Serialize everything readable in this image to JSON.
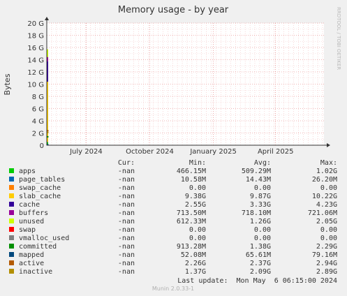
{
  "chart_data": {
    "type": "line",
    "title": "Memory usage - by year",
    "ylabel": "Bytes",
    "xlabel": "",
    "ylim": [
      0,
      20
    ],
    "y_unit": "G",
    "y_ticks": [
      {
        "value": 0,
        "label": "0"
      },
      {
        "value": 2,
        "label": "2 G"
      },
      {
        "value": 4,
        "label": "4 G"
      },
      {
        "value": 6,
        "label": "6 G"
      },
      {
        "value": 8,
        "label": "8 G"
      },
      {
        "value": 10,
        "label": "10 G"
      },
      {
        "value": 12,
        "label": "12 G"
      },
      {
        "value": 14,
        "label": "14 G"
      },
      {
        "value": 16,
        "label": "16 G"
      },
      {
        "value": 18,
        "label": "18 G"
      },
      {
        "value": 20,
        "label": "20 G"
      }
    ],
    "x_range": [
      "2024-05-05",
      "2025-06-10"
    ],
    "x_ticks": [
      {
        "date": "2024-07-01",
        "label": "July 2024"
      },
      {
        "date": "2024-10-01",
        "label": "October 2024"
      },
      {
        "date": "2025-01-01",
        "label": "January 2025"
      },
      {
        "date": "2025-04-01",
        "label": "April 2025"
      }
    ],
    "spike_date": "2024-05-06",
    "stack_order": [
      "apps",
      "page_tables",
      "swap_cache",
      "slab_cache",
      "cache",
      "buffers",
      "unused",
      "swap",
      "vmalloc_used"
    ],
    "line_series": [
      "committed",
      "mapped",
      "active",
      "inactive"
    ],
    "side_text": "RRDTOOL / TOBI OETIKER",
    "legend_headers": {
      "cur": "Cur:",
      "min": "Min:",
      "avg": "Avg:",
      "max": "Max:"
    },
    "series": [
      {
        "name": "apps",
        "color": "#00cc00",
        "cur": "-nan",
        "min": "466.15M",
        "avg": "509.29M",
        "max": "1.02G",
        "value": 0.51
      },
      {
        "name": "page_tables",
        "color": "#0066b3",
        "cur": "-nan",
        "min": "10.58M",
        "avg": "14.43M",
        "max": "26.20M",
        "value": 0.014
      },
      {
        "name": "swap_cache",
        "color": "#ff8000",
        "cur": "-nan",
        "min": "0.00",
        "avg": "0.00",
        "max": "0.00",
        "value": 0
      },
      {
        "name": "slab_cache",
        "color": "#ffcc00",
        "cur": "-nan",
        "min": "9.38G",
        "avg": "9.87G",
        "max": "10.22G",
        "value": 9.87
      },
      {
        "name": "cache",
        "color": "#330099",
        "cur": "-nan",
        "min": "2.55G",
        "avg": "3.33G",
        "max": "4.23G",
        "value": 3.33
      },
      {
        "name": "buffers",
        "color": "#990099",
        "cur": "-nan",
        "min": "713.50M",
        "avg": "718.10M",
        "max": "721.06M",
        "value": 0.718
      },
      {
        "name": "unused",
        "color": "#ccff00",
        "cur": "-nan",
        "min": "612.33M",
        "avg": "1.26G",
        "max": "2.05G",
        "value": 1.26
      },
      {
        "name": "swap",
        "color": "#ff0000",
        "cur": "-nan",
        "min": "0.00",
        "avg": "0.00",
        "max": "0.00",
        "value": 0
      },
      {
        "name": "vmalloc_used",
        "color": "#808080",
        "cur": "-nan",
        "min": "0.00",
        "avg": "0.00",
        "max": "0.00",
        "value": 0
      },
      {
        "name": "committed",
        "color": "#008f00",
        "cur": "-nan",
        "min": "913.28M",
        "avg": "1.38G",
        "max": "2.29G",
        "value": 1.38
      },
      {
        "name": "mapped",
        "color": "#00487d",
        "cur": "-nan",
        "min": "52.08M",
        "avg": "65.61M",
        "max": "79.16M",
        "value": 0.066
      },
      {
        "name": "active",
        "color": "#b35a00",
        "cur": "-nan",
        "min": "2.26G",
        "avg": "2.37G",
        "max": "2.94G",
        "value": 2.37
      },
      {
        "name": "inactive",
        "color": "#b38f00",
        "cur": "-nan",
        "min": "1.37G",
        "avg": "2.09G",
        "max": "2.89G",
        "value": 2.09
      }
    ],
    "last_update": "Last update:  Mon May  6 06:15:00 2024",
    "footer": "Munin 2.0.33-1"
  }
}
